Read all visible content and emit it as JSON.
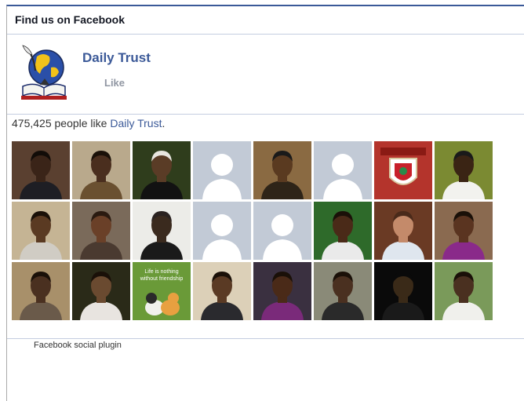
{
  "header": {
    "title": "Find us on Facebook"
  },
  "page": {
    "name": "Daily Trust",
    "like_label": "Like"
  },
  "likes": {
    "count": "475,425",
    "text_before": " people like ",
    "page_link": "Daily Trust",
    "text_after": "."
  },
  "faces": [
    {
      "bg": "#5a4030",
      "skin": "#3a2418",
      "shirt": "#1e1e24",
      "hair": "#120c08"
    },
    {
      "bg": "#b9a98c",
      "skin": "#4a2e1e",
      "shirt": "#6a5030",
      "hair": "#1a1008"
    },
    {
      "bg": "#2f3d1c",
      "skin": "#5a3c26",
      "shirt": "#121212",
      "hair": "#e8e6df"
    },
    {
      "bg": "#c2cad6",
      "silhouette": true
    },
    {
      "bg": "#8a6a42",
      "skin": "#5a3a20",
      "shirt": "#2e2418",
      "hair": "#1a1a1a"
    },
    {
      "bg": "#c2cad6",
      "silhouette": true
    },
    {
      "bg": "#b4342c",
      "badge": true
    },
    {
      "bg": "#7b8a32",
      "skin": "#3a2414",
      "shirt": "#f2f2ee",
      "hair": "#1a1a1a"
    },
    {
      "bg": "#c5b494",
      "skin": "#5a3a22",
      "shirt": "#d0ccc4",
      "hair": "#1a1008"
    },
    {
      "bg": "#7a6a5a",
      "skin": "#6a4028",
      "shirt": "#4a3a30",
      "hair": "#2a1a10"
    },
    {
      "bg": "#ecece8",
      "skin": "#3a2a1e",
      "shirt": "#1a1a1a",
      "hair": "#2a2220"
    },
    {
      "bg": "#c2cad6",
      "silhouette": true
    },
    {
      "bg": "#c2cad6",
      "silhouette": true
    },
    {
      "bg": "#2e6a2a",
      "skin": "#4a2a18",
      "shirt": "#eaeaea",
      "hair": "#1a1008"
    },
    {
      "bg": "#6a3a24",
      "skin": "#c48a6a",
      "shirt": "#dfe6ee",
      "hair": "#4a2a1a"
    },
    {
      "bg": "#8a6a50",
      "skin": "#5a3420",
      "shirt": "#8a2a8a",
      "hair": "#1a1008"
    },
    {
      "bg": "#a8906a",
      "skin": "#4a3020",
      "shirt": "#6a5a4a",
      "hair": "#1a1008"
    },
    {
      "bg": "#2a2a18",
      "skin": "#6a4a30",
      "shirt": "#e8e4e0",
      "hair": "#1a1008"
    },
    {
      "bg": "#6a9a38",
      "poster": true,
      "poster_text": [
        "Life is nothing",
        "without friendship"
      ]
    },
    {
      "bg": "#dcd0b8",
      "skin": "#5a3a24",
      "shirt": "#2a2a2e",
      "hair": "#1a1008"
    },
    {
      "bg": "#3a3040",
      "skin": "#4a2a18",
      "shirt": "#7a2a7a",
      "hair": "#1a1008"
    },
    {
      "bg": "#8a8a78",
      "skin": "#4a3020",
      "shirt": "#2a2a2a",
      "hair": "#1a1008"
    },
    {
      "bg": "#0a0a0a",
      "skin": "#3a2a18",
      "shirt": "#1a1a1a",
      "hair": "#0a0a0a"
    },
    {
      "bg": "#7a9a5a",
      "skin": "#4a3020",
      "shirt": "#f0f0ec",
      "hair": "#1a1008"
    }
  ],
  "footer": {
    "text": "Facebook social plugin"
  }
}
